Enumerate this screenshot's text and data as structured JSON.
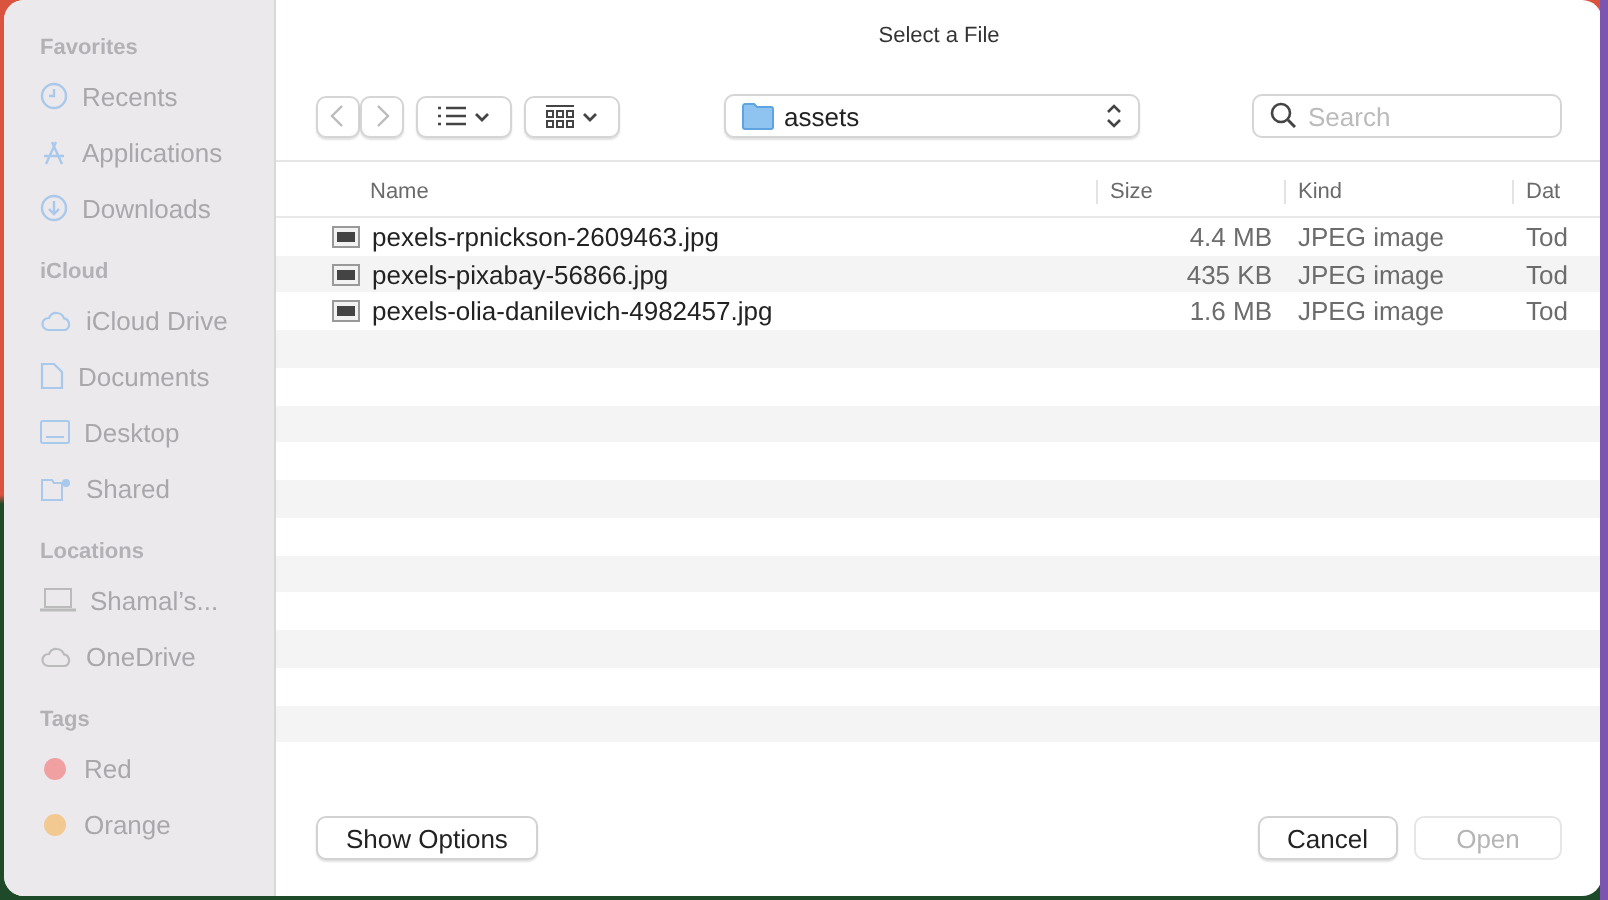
{
  "window": {
    "title": "Select a File"
  },
  "sidebar": {
    "sections": [
      {
        "heading": "Favorites",
        "items": [
          {
            "label": "Recents"
          },
          {
            "label": "Applications"
          },
          {
            "label": "Downloads"
          }
        ]
      },
      {
        "heading": "iCloud",
        "items": [
          {
            "label": "iCloud Drive"
          },
          {
            "label": "Documents"
          },
          {
            "label": "Desktop"
          },
          {
            "label": "Shared"
          }
        ]
      },
      {
        "heading": "Locations",
        "items": [
          {
            "label": "Shamal’s..."
          },
          {
            "label": "OneDrive"
          }
        ]
      },
      {
        "heading": "Tags",
        "items": [
          {
            "label": "Red",
            "color": "#f0a0a0"
          },
          {
            "label": "Orange",
            "color": "#f2c990"
          }
        ]
      }
    ]
  },
  "toolbar": {
    "back_disabled": true,
    "forward_disabled": true,
    "location": "assets",
    "search": {
      "placeholder": "Search"
    }
  },
  "table": {
    "columns": [
      "Name",
      "Size",
      "Kind",
      "Dat"
    ],
    "rows": [
      {
        "name": "pexels-rpnickson-2609463.jpg",
        "size": "4.4 MB",
        "kind": "JPEG image",
        "date": "Tod",
        "selected": false
      },
      {
        "name": "pexels-pixabay-56866.jpg",
        "size": "435 KB",
        "kind": "JPEG image",
        "date": "Tod",
        "selected": false
      },
      {
        "name": "pexels-olia-danilevich-4982457.jpg",
        "size": "1.6 MB",
        "kind": "JPEG image",
        "date": "Tod",
        "selected": false
      }
    ]
  },
  "footer": {
    "options_button": "Show Options",
    "cancel_button": "Cancel",
    "open_button": {
      "label": "Open",
      "disabled": true
    }
  }
}
